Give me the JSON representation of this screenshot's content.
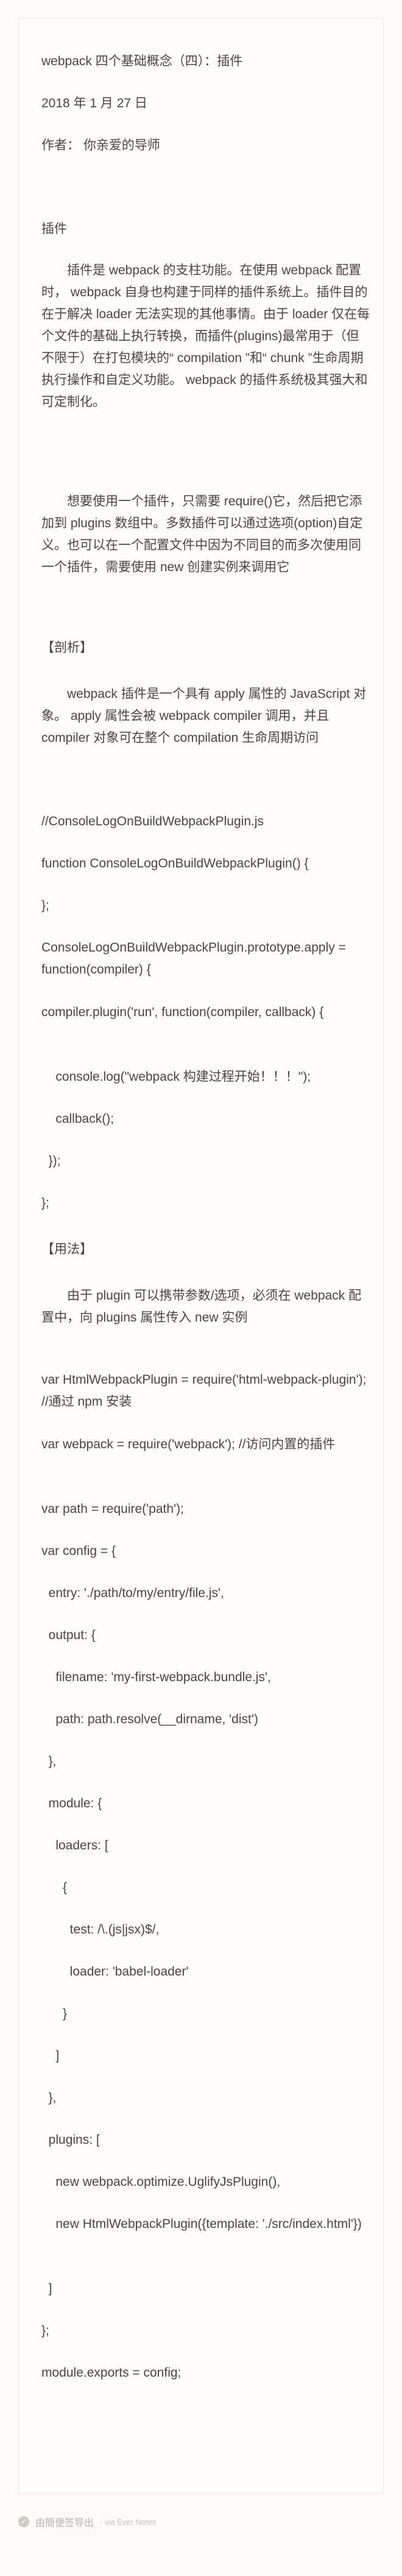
{
  "header": {
    "title": "webpack 四个基础概念（四）：插件",
    "date": "2018 年 1 月 27 日",
    "author": "作者： 你亲爱的导师"
  },
  "article": {
    "section_heading": "插件",
    "intro_paragraph": "插件是 webpack 的支柱功能。在使用 webpack 配置时， webpack 自身也构建于同样的插件系统上。插件目的在于解决 loader 无法实现的其他事情。由于 loader 仅在每个文件的基础上执行转换，而插件(plugins)最常用于（但不限于）在打包模块的“ compilation ”和“ chunk ”生命周期执行操作和自定义功能。 webpack 的插件系统极其强大和可定制化。",
    "usage_paragraph": "想要使用一个插件，只需要 require()它，然后把它添加到 plugins 数组中。多数插件可以通过选项(option)自定义。也可以在一个配置文件中因为不同目的而多次使用同一个插件，需要使用 new 创建实例来调用它",
    "analysis_heading": "【剖析】",
    "analysis_paragraph": "webpack 插件是一个具有 apply 属性的 JavaScript 对象。 apply 属性会被 webpack compiler 调用，并且 compiler 对象可在整个 compilation 生命周期访问",
    "code1": [
      "//ConsoleLogOnBuildWebpackPlugin.js",
      "function ConsoleLogOnBuildWebpackPlugin() {",
      "};",
      "ConsoleLogOnBuildWebpackPlugin.prototype.apply = function(compiler) {",
      "  compiler.plugin('run', function(compiler, callback) {",
      "    console.log(\"webpack 构建过程开始！！！\");",
      "    callback();",
      "  });",
      "};"
    ],
    "usage_heading": "【用法】",
    "usage_paragraph2": "由于 plugin 可以携带参数/选项，必须在 webpack 配置中，向 plugins 属性传入 new 实例",
    "code2": [
      "var HtmlWebpackPlugin = require('html-webpack-plugin'); //通过 npm 安装",
      "var webpack = require('webpack'); //访问内置的插件",
      "var path = require('path');",
      "var config = {",
      "  entry: './path/to/my/entry/file.js',",
      "  output: {",
      "    filename: 'my-first-webpack.bundle.js',",
      "    path: path.resolve(__dirname, 'dist')",
      "  },",
      "  module: {",
      "    loaders: [",
      "      {",
      "        test: /\\.(js|jsx)$/,",
      "        loader: 'babel-loader'",
      "      }",
      "    ]",
      "  },",
      "  plugins: [",
      "    new webpack.optimize.UglifyJsPlugin(),",
      "    new HtmlWebpackPlugin({template: './src/index.html'})",
      "  ]",
      "};",
      "module.exports = config;"
    ]
  },
  "footer": {
    "brand": "由簡便签导出",
    "via": "- via Ever Notes"
  }
}
